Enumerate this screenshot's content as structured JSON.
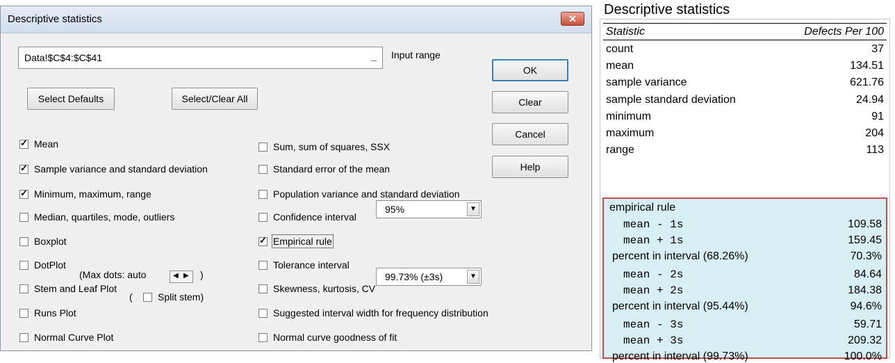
{
  "dialog": {
    "title": "Descriptive statistics",
    "close_label": "✕",
    "input_range_value": "Data!$C$4:$C$41",
    "input_collapse_label": "_",
    "input_range_label": "Input range",
    "buttons": {
      "ok": "OK",
      "clear": "Clear",
      "cancel": "Cancel",
      "help": "Help",
      "select_defaults": "Select Defaults",
      "select_clear_all": "Select/Clear All"
    },
    "left_options": [
      {
        "label": "Mean",
        "checked": true
      },
      {
        "label": "Sample variance and standard deviation",
        "checked": true
      },
      {
        "label": "Minimum, maximum, range",
        "checked": true
      },
      {
        "label": "Median, quartiles, mode, outliers",
        "checked": false
      },
      {
        "label": "Boxplot",
        "checked": false
      },
      {
        "label": "DotPlot",
        "checked": false
      },
      {
        "label": "Stem and Leaf Plot",
        "checked": false
      },
      {
        "label": "Runs Plot",
        "checked": false
      },
      {
        "label": "Normal Curve Plot",
        "checked": false
      }
    ],
    "dotplot_max_label": "(Max dots: auto",
    "dotplot_close": ")",
    "split_stem_open": "(",
    "split_stem_label": "Split stem)",
    "split_stem_checked": false,
    "right_options": [
      {
        "label": "Sum, sum of squares, SSX",
        "checked": false
      },
      {
        "label": "Standard error of the mean",
        "checked": false
      },
      {
        "label": "Population variance and standard deviation",
        "checked": false
      },
      {
        "label": "Confidence interval",
        "checked": false
      },
      {
        "label": "Empirical rule",
        "checked": true
      },
      {
        "label": "Tolerance interval",
        "checked": false
      },
      {
        "label": "Skewness, kurtosis, CV",
        "checked": false
      },
      {
        "label": "Suggested interval width for frequency distribution",
        "checked": false
      },
      {
        "label": "Normal curve goodness of fit",
        "checked": false
      }
    ],
    "confidence_value": "95%",
    "tolerance_value": "99.73% (±3s)"
  },
  "output": {
    "title": "Descriptive statistics",
    "header": {
      "statistic": "Statistic",
      "column": "Defects Per 100"
    },
    "rows": [
      {
        "label": "count",
        "value": "37"
      },
      {
        "label": "mean",
        "value": "134.51"
      },
      {
        "label": "sample variance",
        "value": "621.76"
      },
      {
        "label": "sample standard deviation",
        "value": "24.94"
      },
      {
        "label": "minimum",
        "value": "91"
      },
      {
        "label": "maximum",
        "value": "204"
      },
      {
        "label": "range",
        "value": "113"
      }
    ],
    "empirical": {
      "title": "empirical rule",
      "groups": [
        {
          "lower_label": "mean - 1s",
          "lower_value": "109.58",
          "upper_label": "mean + 1s",
          "upper_value": "159.45",
          "pct_label": "percent in interval (68.26%)",
          "pct_value": "70.3%"
        },
        {
          "lower_label": "mean - 2s",
          "lower_value": "84.64",
          "upper_label": "mean + 2s",
          "upper_value": "184.38",
          "pct_label": "percent in interval (95.44%)",
          "pct_value": "94.6%"
        },
        {
          "lower_label": "mean - 3s",
          "lower_value": "59.71",
          "upper_label": "mean + 3s",
          "upper_value": "209.32",
          "pct_label": "percent in interval (99.73%)",
          "pct_value": "100.0%"
        }
      ]
    }
  }
}
